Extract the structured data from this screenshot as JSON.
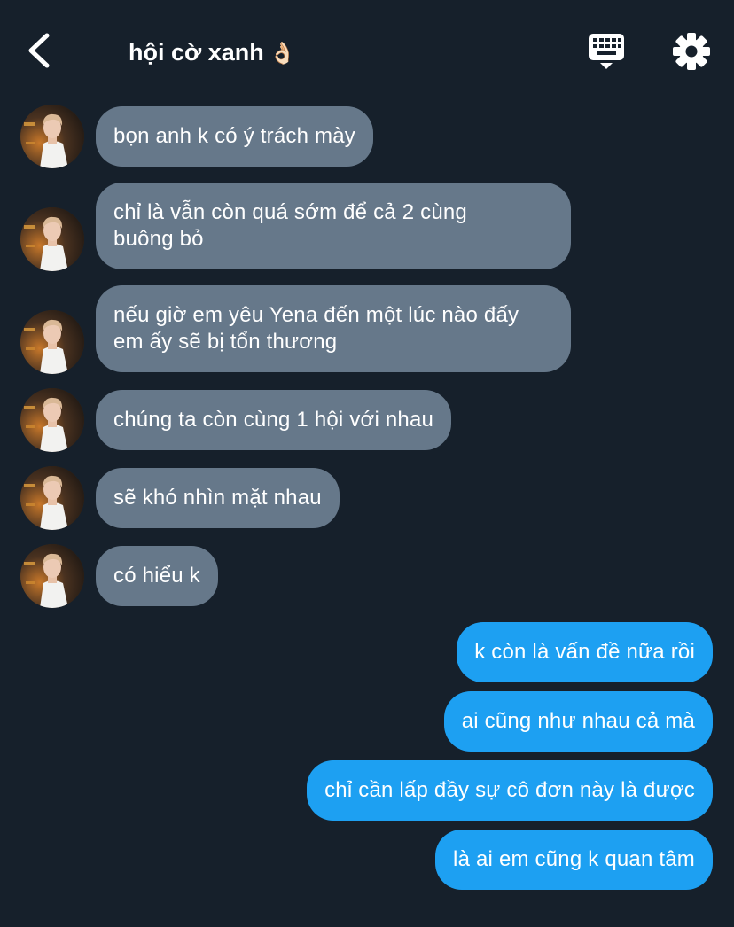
{
  "header": {
    "title": "hội cờ xanh",
    "title_emoji": "👌🏻",
    "back_icon": "chevron-left-icon",
    "keyboard_icon": "keyboard-icon",
    "settings_icon": "gear-icon"
  },
  "colors": {
    "background": "#16202b",
    "incoming_bubble": "#66788a",
    "outgoing_bubble": "#1da0f2",
    "text": "#ffffff"
  },
  "messages": [
    {
      "side": "in",
      "text": "bọn anh k có ý trách mày"
    },
    {
      "side": "in",
      "text": "chỉ là vẫn còn quá sớm để cả 2 cùng\nbuông bỏ"
    },
    {
      "side": "in",
      "text": "nếu giờ em yêu Yena đến một lúc nào đấy\nem ấy sẽ bị tổn thương"
    },
    {
      "side": "in",
      "text": "chúng ta còn cùng 1 hội với nhau"
    },
    {
      "side": "in",
      "text": "sẽ khó nhìn mặt nhau"
    },
    {
      "side": "in",
      "text": "có hiểu k"
    },
    {
      "side": "out",
      "text": "k còn là vấn đề nữa rồi"
    },
    {
      "side": "out",
      "text": "ai cũng như nhau cả mà"
    },
    {
      "side": "out",
      "text": "chỉ cần lấp đầy sự cô đơn này là được"
    },
    {
      "side": "out",
      "text": "là ai em cũng k quan tâm"
    }
  ]
}
